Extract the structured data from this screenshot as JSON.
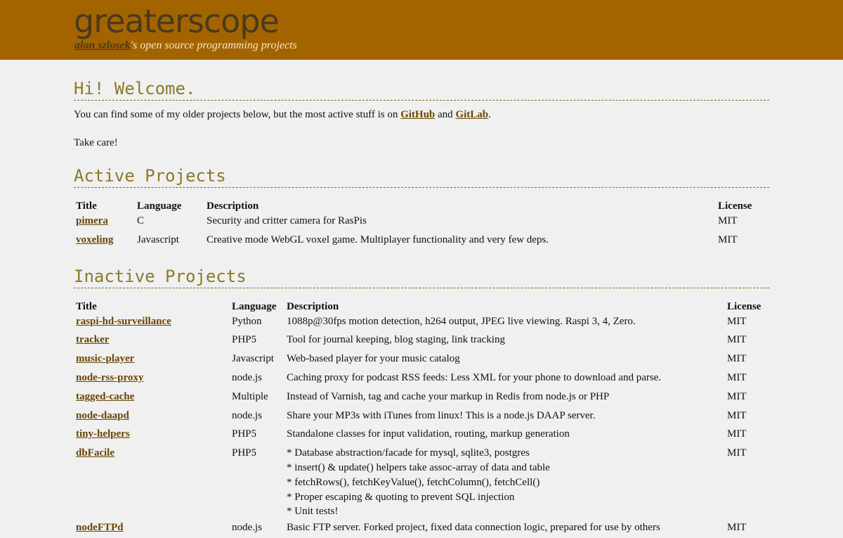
{
  "header": {
    "title": "greaterscope",
    "author_link": "alan szlosek",
    "tagline_rest": "'s open source programming projects"
  },
  "welcome": {
    "heading": "Hi! Welcome.",
    "text_before": "You can find some of my older projects below, but the most active stuff is on ",
    "github_link": "GitHub",
    "text_and": " and ",
    "gitlab_link": "GitLab",
    "text_end": ".",
    "take_care": "Take care!"
  },
  "active": {
    "heading": "Active Projects",
    "columns": [
      "Title",
      "Language",
      "Description",
      "License"
    ],
    "rows": [
      {
        "title": "pimera",
        "language": "C",
        "description": "Security and critter camera for RasPis",
        "license": "MIT"
      },
      {
        "title": "voxeling",
        "language": "Javascript",
        "description": "Creative mode WebGL voxel game. Multiplayer functionality and very few deps.",
        "license": "MIT"
      }
    ]
  },
  "inactive": {
    "heading": "Inactive Projects",
    "columns": [
      "Title",
      "Language",
      "Description",
      "License"
    ],
    "rows": [
      {
        "title": "raspi-hd-surveillance",
        "language": "Python",
        "description": [
          "1088p@30fps motion detection, h264 output, JPEG live viewing. Raspi 3, 4, Zero."
        ],
        "license": "MIT"
      },
      {
        "title": "tracker",
        "language": "PHP5",
        "description": [
          "Tool for journal keeping, blog staging, link tracking"
        ],
        "license": "MIT"
      },
      {
        "title": "music-player",
        "language": "Javascript",
        "description": [
          "Web-based player for your music catalog"
        ],
        "license": "MIT"
      },
      {
        "title": "node-rss-proxy",
        "language": "node.js",
        "description": [
          "Caching proxy for podcast RSS feeds: Less XML for your phone to download and parse."
        ],
        "license": "MIT"
      },
      {
        "title": "tagged-cache",
        "language": "Multiple",
        "description": [
          "Instead of Varnish, tag and cache your markup in Redis from node.js or PHP"
        ],
        "license": "MIT"
      },
      {
        "title": "node-daapd",
        "language": "node.js",
        "description": [
          "Share your MP3s with iTunes from linux! This is a node.js DAAP server."
        ],
        "license": "MIT"
      },
      {
        "title": "tiny-helpers",
        "language": "PHP5",
        "description": [
          "Standalone classes for input validation, routing, markup generation"
        ],
        "license": "MIT"
      },
      {
        "title": "dbFacile",
        "language": "PHP5",
        "description": [
          "* Database abstraction/facade for mysql, sqlite3, postgres",
          "* insert() & update() helpers take assoc-array of data and table",
          "* fetchRows(), fetchKeyValue(), fetchColumn(), fetchCell()",
          "* Proper escaping & quoting to prevent SQL injection",
          "* Unit tests!"
        ],
        "license": "MIT"
      },
      {
        "title": "nodeFTPd",
        "language": "node.js",
        "description": [
          "Basic FTP server. Forked project, fixed data connection logic, prepared for use by others"
        ],
        "license": "MIT"
      }
    ]
  }
}
